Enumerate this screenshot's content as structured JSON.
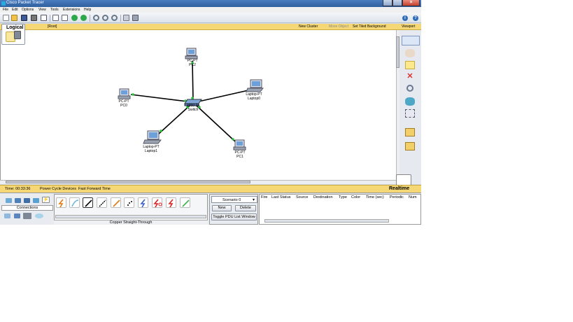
{
  "window": {
    "title": "Cisco Packet Tracer"
  },
  "menu": [
    "File",
    "Edit",
    "Options",
    "View",
    "Tools",
    "Extensions",
    "Help"
  ],
  "workspace": {
    "tab_label": "Logical",
    "root_label": "[Root]",
    "links": {
      "new_cluster": "New Cluster",
      "move_object": "Move Object",
      "set_tiled_background": "Set Tiled Background",
      "viewport": "Viewport"
    }
  },
  "devices": {
    "pc2": {
      "type": "PC-PT",
      "name": "PC2"
    },
    "laptop0": {
      "type": "Laptop-PT",
      "name": "Laptop0"
    },
    "pc0": {
      "type": "PC-PT",
      "name": "PC0"
    },
    "switch": {
      "type": "2950-24",
      "name": "Switch"
    },
    "laptop1": {
      "type": "Laptop-PT",
      "name": "Laptop1"
    },
    "pc1": {
      "type": "PC-PT",
      "name": "PC1"
    }
  },
  "statusbar": {
    "time": "Time: 00:33:36",
    "power_cycle": "Power Cycle Devices",
    "fast_forward": "Fast Forward Time",
    "mode": "Realtime"
  },
  "bottom": {
    "connections_label": "Connections",
    "selected_cable": "Copper Straight-Through",
    "scenario": "Scenario 0",
    "new_button": "New",
    "delete_button": "Delete",
    "toggle_button": "Toggle PDU List Window",
    "pdu_columns": [
      "Fire",
      "Last Status",
      "Source",
      "Destination",
      "Type",
      "Color",
      "Time (sec)",
      "Periodic",
      "Num"
    ]
  },
  "colors": {
    "accent_yellow": "#f5d775",
    "titlebar": "#2f5f9f",
    "link_green": "#2ec23a"
  }
}
